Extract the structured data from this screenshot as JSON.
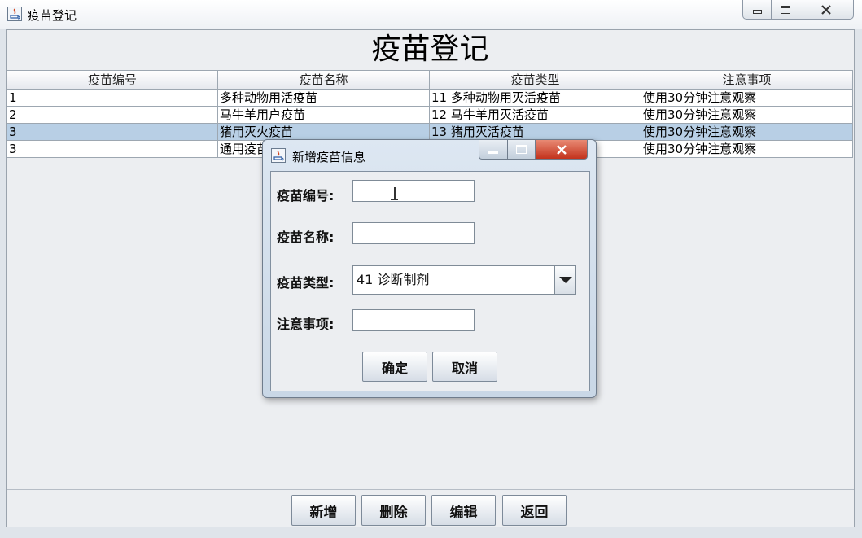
{
  "window": {
    "title": "疫苗登记",
    "heading": "疫苗登记"
  },
  "table": {
    "columns": [
      "疫苗编号",
      "疫苗名称",
      "疫苗类型",
      "注意事项"
    ],
    "rows": [
      {
        "id": "1",
        "name": "多种动物用活疫苗",
        "type": "11  多种动物用灭活疫苗",
        "note": "使用30分钟注意观察",
        "selected": false
      },
      {
        "id": "2",
        "name": "马牛羊用户疫苗",
        "type": "12  马牛羊用灭活疫苗",
        "note": "使用30分钟注意观察",
        "selected": false
      },
      {
        "id": "3",
        "name": "猪用灭火疫苗",
        "type": "13  猪用灭活疫苗",
        "note": "使用30分钟注意观察",
        "selected": true
      },
      {
        "id": "3",
        "name": "通用疫苗",
        "type": "",
        "note": "使用30分钟注意观察",
        "selected": false
      }
    ]
  },
  "buttons": {
    "add": "新增",
    "delete": "删除",
    "edit": "编辑",
    "back": "返回"
  },
  "dialog": {
    "title": "新增疫苗信息",
    "fields": {
      "id_label": "疫苗编号:",
      "id_value": "",
      "name_label": "疫苗名称:",
      "name_value": "",
      "type_label": "疫苗类型:",
      "type_selected": "41  诊断制剂",
      "note_label": "注意事项:",
      "note_value": ""
    },
    "confirm": "确定",
    "cancel": "取消"
  },
  "colors": {
    "selected_row": "#b8cfe5",
    "close_button": "#c3321c"
  }
}
